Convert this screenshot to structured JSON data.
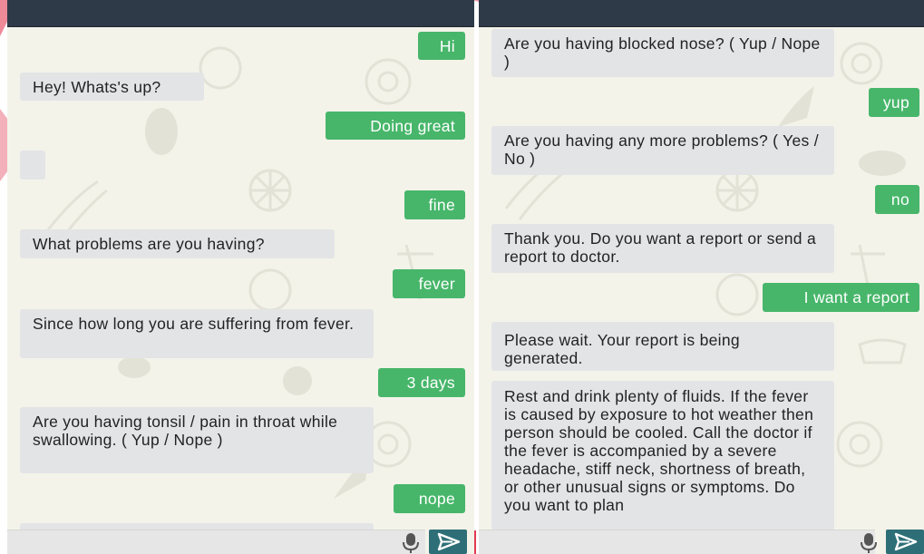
{
  "colors": {
    "header": "#2e3a47",
    "background": "#f4f3ea",
    "bot_bubble": "#e3e4e6",
    "user_bubble": "#47b66a",
    "send_button": "#2e6f77",
    "accent": "#e23a52"
  },
  "left_chat": {
    "messages": [
      {
        "from": "user",
        "text": "Hi"
      },
      {
        "from": "bot",
        "text": "Hey! Whats's up?"
      },
      {
        "from": "user",
        "text": "Doing great"
      },
      {
        "from": "bot",
        "text": ""
      },
      {
        "from": "user",
        "text": "fine"
      },
      {
        "from": "bot",
        "text": "What problems are you having?"
      },
      {
        "from": "user",
        "text": "fever"
      },
      {
        "from": "bot",
        "text": "Since how long you are suffering from fever."
      },
      {
        "from": "user",
        "text": "3 days"
      },
      {
        "from": "bot",
        "text": "Are you having tonsil / pain in throat while swallowing. ( Yup / Nope )"
      },
      {
        "from": "user",
        "text": "nope"
      }
    ]
  },
  "right_chat": {
    "messages": [
      {
        "from": "bot",
        "text": "Are you having blocked nose? ( Yup / Nope )"
      },
      {
        "from": "user",
        "text": "yup"
      },
      {
        "from": "bot",
        "text": "Are you having any more problems? ( Yes / No )"
      },
      {
        "from": "user",
        "text": "no"
      },
      {
        "from": "bot",
        "text": "Thank you. Do you want a report or send a report to doctor."
      },
      {
        "from": "user",
        "text": "I want a report"
      },
      {
        "from": "bot",
        "text": "Please wait. Your report is being generated."
      },
      {
        "from": "bot",
        "text": "Rest and drink plenty of fluids. If the fever is caused by exposure to hot weather then person should be cooled. Call the doctor if the fever is accompanied by a severe headache, stiff neck, shortness of breath, or other unusual signs or symptoms. Do you want to plan"
      }
    ]
  },
  "icons": {
    "mic": "microphone-icon",
    "send": "send-icon"
  }
}
